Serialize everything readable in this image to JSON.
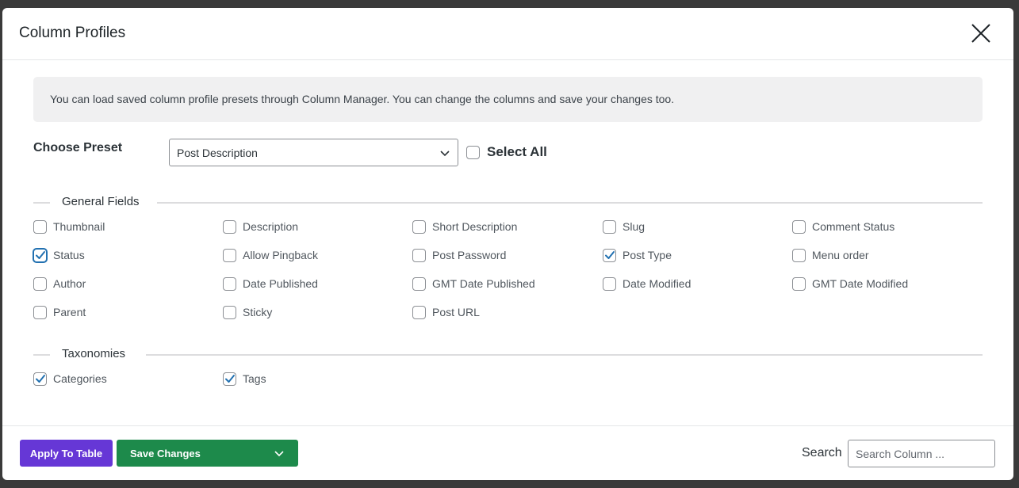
{
  "modal": {
    "title": "Column Profiles",
    "notice": "You can load saved column profile presets through Column Manager. You can change the columns and save your changes too."
  },
  "preset": {
    "label": "Choose Preset",
    "selected": "Post Description",
    "select_all_label": "Select All",
    "select_all_checked": false
  },
  "sections": {
    "general": {
      "title": "General Fields",
      "fields": [
        {
          "label": "Thumbnail",
          "checked": false
        },
        {
          "label": "Description",
          "checked": false
        },
        {
          "label": "Short Description",
          "checked": false
        },
        {
          "label": "Slug",
          "checked": false
        },
        {
          "label": "Comment Status",
          "checked": false
        },
        {
          "label": "Status",
          "checked": true
        },
        {
          "label": "Allow Pingback",
          "checked": false
        },
        {
          "label": "Post Password",
          "checked": false
        },
        {
          "label": "Post Type",
          "checked": true
        },
        {
          "label": "Menu order",
          "checked": false
        },
        {
          "label": "Author",
          "checked": false
        },
        {
          "label": "Date Published",
          "checked": false
        },
        {
          "label": "GMT Date Published",
          "checked": false
        },
        {
          "label": "Date Modified",
          "checked": false
        },
        {
          "label": "GMT Date Modified",
          "checked": false
        },
        {
          "label": "Parent",
          "checked": false
        },
        {
          "label": "Sticky",
          "checked": false
        },
        {
          "label": "Post URL",
          "checked": false
        }
      ]
    },
    "taxonomies": {
      "title": "Taxonomies",
      "fields": [
        {
          "label": "Categories",
          "checked": true
        },
        {
          "label": "Tags",
          "checked": true
        }
      ]
    }
  },
  "footer": {
    "apply_label": "Apply To Table",
    "save_label": "Save Changes",
    "search_label": "Search",
    "search_placeholder": "Search Column ...",
    "search_value": ""
  },
  "colors": {
    "apply_button": "#6637d6",
    "save_button": "#1d8a4b",
    "checkmark": "#2271b1"
  }
}
